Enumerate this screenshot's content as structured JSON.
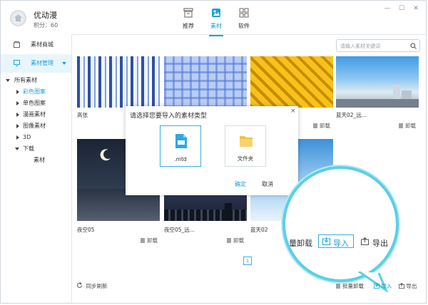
{
  "app": {
    "title": "优动漫",
    "credits": "积分：60"
  },
  "tabs": [
    {
      "label": "推荐",
      "icon": "recommend-icon"
    },
    {
      "label": "素材",
      "icon": "material-icon",
      "active": true
    },
    {
      "label": "软件",
      "icon": "software-icon"
    }
  ],
  "window_controls": {
    "minimize": "—",
    "maximize": "☐",
    "close": "✕"
  },
  "sidebar": {
    "store_label": "素材商城",
    "manage_label": "素材管理",
    "tree": {
      "root": "所有素材",
      "children": [
        "彩色图案",
        "单色图案",
        "漫画素材",
        "图像素材",
        "3D",
        "下载"
      ],
      "download_child": "素材"
    }
  },
  "search": {
    "placeholder": "请输入素材关键词"
  },
  "thumbnails": [
    {
      "caption": "高张",
      "unload": ""
    },
    {
      "caption": "",
      "unload": ""
    },
    {
      "caption": "",
      "unload": "卸载"
    },
    {
      "caption": "蓝天02_远...",
      "unload": "卸载"
    },
    {
      "caption": "夜空05",
      "unload": "卸载"
    },
    {
      "caption": "夜空05_远...",
      "unload": "卸载"
    },
    {
      "caption": "蓝天02",
      "unload": ""
    }
  ],
  "dialog": {
    "title": "请选择您要导入的素材类型",
    "close": "×",
    "options": [
      {
        "label": ".mtd"
      },
      {
        "label": "文件夹"
      }
    ],
    "confirm": "确定",
    "cancel": "取消"
  },
  "magnifier": {
    "batch_unload": "批量卸载",
    "import": "导入",
    "export": "导出"
  },
  "pager": {
    "page": "1"
  },
  "bottom": {
    "sync_refresh": "同步刷新",
    "batch_unload": "批量卸载",
    "import": "导入",
    "export": "导出"
  },
  "colors": {
    "accent": "#1aa3d8",
    "magnifier_ring": "#5ccfe3",
    "active_nav_bg": "#e8f6fc"
  }
}
